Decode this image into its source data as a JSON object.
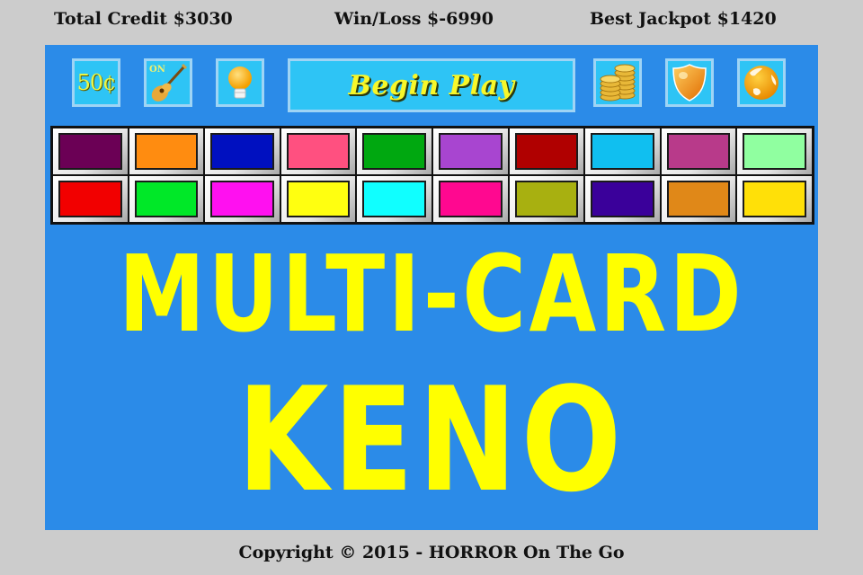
{
  "header": {
    "total_credit": "Total Credit $3030",
    "win_loss": "Win/Loss $-6990",
    "best_jackpot": "Best Jackpot $1420"
  },
  "toolbar": {
    "bet_amount": "50¢",
    "music_status": "ON",
    "begin_play_label": "Begin Play",
    "icons": [
      "coin-bet-icon",
      "guitar-music-icon",
      "lightbulb-hint-icon",
      "coin-stack-icon",
      "shield-icon",
      "globe-icon"
    ]
  },
  "card_colors": {
    "row1": [
      "#6b0055",
      "#ff8c10",
      "#0010c0",
      "#ff5080",
      "#00a810",
      "#a845d0",
      "#b00000",
      "#10bff0",
      "#b83a8a",
      "#90ffa0"
    ],
    "row2": [
      "#f20000",
      "#00e828",
      "#ff10f0",
      "#ffff10",
      "#10ffff",
      "#ff0890",
      "#a8b010",
      "#3a009a",
      "#e08818",
      "#ffe008"
    ]
  },
  "title": {
    "line1": "MULTI-CARD",
    "line2": "KENO"
  },
  "footer": {
    "copyright": "Copyright © 2015 -  HORROR On The Go"
  },
  "colors": {
    "background": "#cccccc",
    "panel": "#2b8be8",
    "button": "#2ec4f5",
    "title_text": "#ffff00"
  }
}
